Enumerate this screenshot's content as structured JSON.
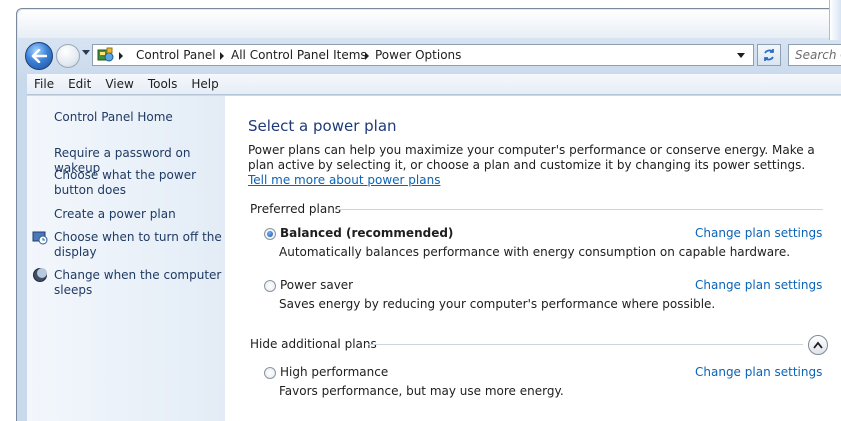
{
  "address_bar": {
    "crumbs": [
      "Control Panel",
      "All Control Panel Items",
      "Power Options"
    ],
    "search_placeholder": "Search Co"
  },
  "menu": {
    "items": [
      "File",
      "Edit",
      "View",
      "Tools",
      "Help"
    ]
  },
  "sidebar": {
    "home": "Control Panel Home",
    "links": [
      "Require a password on wakeup",
      "Choose what the power button does",
      "Create a power plan",
      "Choose when to turn off the display",
      "Change when the computer sleeps"
    ]
  },
  "main": {
    "title": "Select a power plan",
    "intro": "Power plans can help you maximize your computer's performance or conserve energy. Make a plan active by selecting it, or choose a plan and customize it by changing its power settings.",
    "intro_link": "Tell me more about power plans",
    "preferred_heading": "Preferred plans",
    "additional_heading": "Hide additional plans",
    "change_link": "Change plan settings",
    "plans": [
      {
        "name": "Balanced (recommended)",
        "desc": "Automatically balances performance with energy consumption on capable hardware.",
        "selected": true
      },
      {
        "name": "Power saver",
        "desc": "Saves energy by reducing your computer's performance where possible.",
        "selected": false
      },
      {
        "name": "High performance",
        "desc": "Favors performance, but may use more energy.",
        "selected": false
      }
    ]
  },
  "colors": {
    "link": "#0b63b6",
    "title": "#1e3b78",
    "sidebar_link": "#1f3a63"
  }
}
